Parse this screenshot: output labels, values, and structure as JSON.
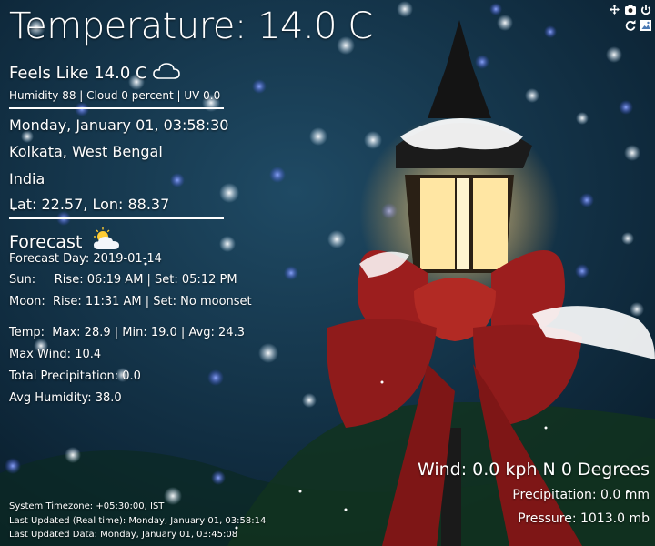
{
  "title": "Temperature: 14.0 C",
  "feels_like": "Feels Like 14.0 C",
  "conditions": "Humidity 88 | Cloud 0 percent | UV 0.0",
  "datetime": "Monday, January 01, 03:58:30",
  "city": "Kolkata, West Bengal",
  "country": "India",
  "coords": "Lat: 22.57, Lon: 88.37",
  "forecast": {
    "heading": "Forecast",
    "day": "Forecast Day: 2019-01-14",
    "sun": "Sun:     Rise: 06:19 AM | Set: 05:12 PM",
    "moon": "Moon:  Rise: 11:31 AM | Set: No moonset",
    "temp": "Temp:  Max: 28.9 | Min: 19.0 | Avg: 24.3",
    "wind": "Max Wind: 10.4",
    "precip": "Total Precipitation: 0.0",
    "humidity": "Avg Humidity: 38.0"
  },
  "wind_now": "Wind: 0.0 kph N 0 Degrees",
  "precip_now": "Precipitation: 0.0 mm",
  "pressure_now": "Pressure: 1013.0 mb",
  "footer": {
    "timezone": "System Timezone: +05:30:00, IST",
    "updated_real": "Last Updated (Real time): Monday, January 01, 03:58:14",
    "updated_data": "Last Updated Data: Monday, January 01, 03:45:08"
  },
  "controls": {
    "icons": [
      "move-icon",
      "camera-icon",
      "power-icon",
      "refresh-icon",
      "image-icon"
    ]
  }
}
